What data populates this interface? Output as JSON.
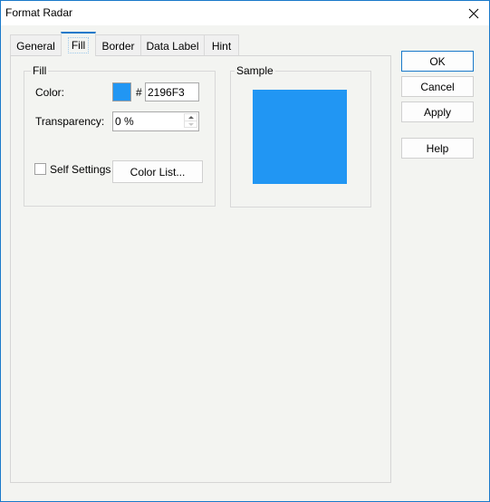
{
  "window": {
    "title": "Format Radar",
    "close_icon": "close-icon"
  },
  "tabs": [
    {
      "label": "General",
      "active": false
    },
    {
      "label": "Fill",
      "active": true
    },
    {
      "label": "Border",
      "active": false
    },
    {
      "label": "Data Label",
      "active": false
    },
    {
      "label": "Hint",
      "active": false
    }
  ],
  "fill_group": {
    "title": "Fill",
    "color_label": "Color:",
    "color_value": "#2196F3",
    "hash_symbol": "#",
    "hex_value": "2196F3",
    "transparency_label": "Transparency:",
    "transparency_value": "0 %",
    "self_settings_label": "Self Settings",
    "self_settings_checked": false,
    "color_list_button": "Color List..."
  },
  "sample_group": {
    "title": "Sample",
    "sample_color": "#2196F3"
  },
  "buttons": {
    "ok": "OK",
    "cancel": "Cancel",
    "apply": "Apply",
    "help": "Help"
  },
  "colors": {
    "accent": "#1979CA",
    "fill": "#2196F3"
  }
}
